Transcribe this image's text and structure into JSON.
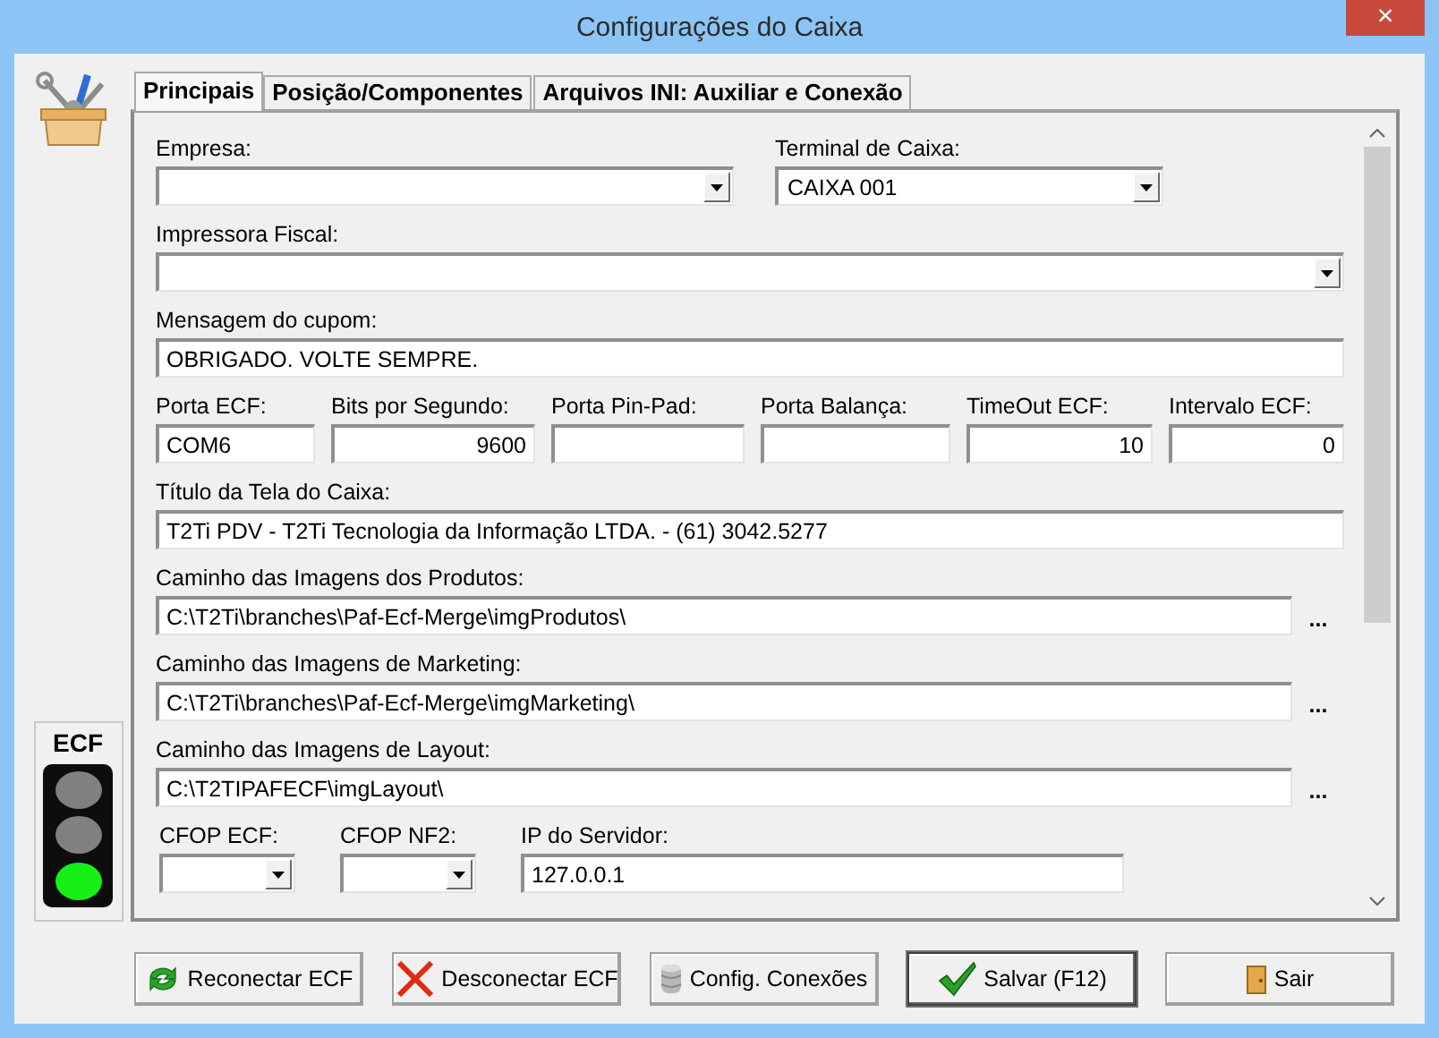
{
  "window": {
    "title": "Configurações do Caixa",
    "close": "×"
  },
  "tabs": [
    {
      "label": "Principais",
      "selected": true
    },
    {
      "label": "Posição/Componentes",
      "selected": false
    },
    {
      "label": "Arquivos INI: Auxiliar e Conexão",
      "selected": false
    }
  ],
  "ecf_status": {
    "label": "ECF",
    "lights": [
      {
        "on": false
      },
      {
        "on": false
      },
      {
        "on": true
      }
    ]
  },
  "form": {
    "rows": [
      {
        "kind": "pair",
        "fields": [
          {
            "kind": "combo",
            "label": "Empresa:"
          },
          {
            "kind": "combo",
            "label": "Terminal de Caixa:",
            "value": "CAIXA 001"
          }
        ]
      },
      {
        "kind": "wide",
        "fields": [
          {
            "kind": "combo",
            "label": "Impressora Fiscal:"
          }
        ]
      },
      {
        "kind": "wide",
        "fields": [
          {
            "kind": "text",
            "label": "Mensagem do cupom:",
            "value": "OBRIGADO. VOLTE SEMPRE."
          }
        ]
      },
      {
        "kind": "six",
        "fields": [
          {
            "kind": "text",
            "label": "Porta ECF:",
            "value": "COM6"
          },
          {
            "kind": "number",
            "label": "Bits por Segundo:",
            "value": "9600"
          },
          {
            "kind": "text",
            "label": "Porta Pin-Pad:"
          },
          {
            "kind": "text",
            "label": "Porta Balança:"
          },
          {
            "kind": "number",
            "label": "TimeOut ECF:",
            "value": "10"
          },
          {
            "kind": "number",
            "label": "Intervalo ECF:",
            "value": "0"
          }
        ]
      },
      {
        "kind": "wide",
        "fields": [
          {
            "kind": "text",
            "label": "Título da Tela do Caixa:",
            "value": "T2Ti PDV - T2Ti Tecnologia da Informação LTDA. - (61) 3042.5277"
          }
        ]
      },
      {
        "kind": "path",
        "fields": [
          {
            "kind": "path",
            "label": "Caminho das Imagens dos Produtos:",
            "value": "C:\\T2Ti\\branches\\Paf-Ecf-Merge\\imgProdutos\\",
            "browse": "..."
          }
        ]
      },
      {
        "kind": "path",
        "fields": [
          {
            "kind": "path",
            "label": "Caminho das Imagens de Marketing:",
            "value": "C:\\T2Ti\\branches\\Paf-Ecf-Merge\\imgMarketing\\",
            "browse": "..."
          }
        ]
      },
      {
        "kind": "path",
        "fields": [
          {
            "kind": "path",
            "label": "Caminho das Imagens de Layout:",
            "value": "C:\\T2TIPAFECF\\imgLayout\\",
            "browse": "..."
          }
        ]
      },
      {
        "kind": "cfop",
        "fields": [
          {
            "kind": "combo",
            "label": "CFOP ECF:"
          },
          {
            "kind": "combo",
            "label": "CFOP NF2:"
          },
          {
            "kind": "text",
            "label": "IP do Servidor:",
            "value": "127.0.0.1"
          }
        ]
      }
    ]
  },
  "buttons": [
    {
      "label": "Reconectar ECF",
      "default": false
    },
    {
      "label": "Desconectar ECF",
      "default": false
    },
    {
      "label": "Config. Conexões",
      "default": false
    },
    {
      "label": "Salvar (F12)",
      "default": true
    },
    {
      "label": "Sair",
      "default": false
    }
  ]
}
